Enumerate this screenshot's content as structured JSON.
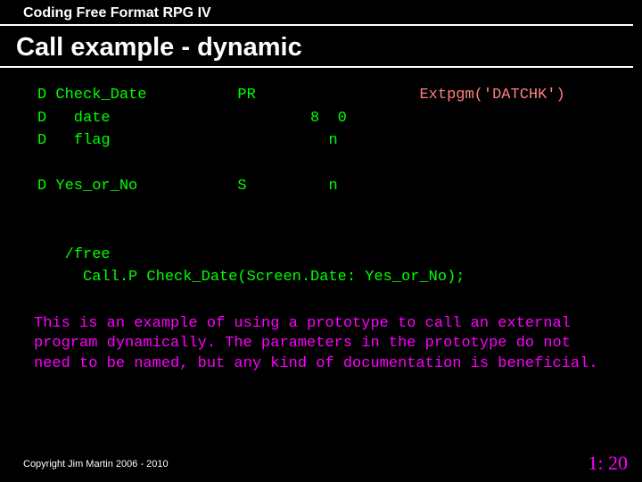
{
  "header": "Coding Free Format RPG IV",
  "title": "Call example - dynamic",
  "code": {
    "l1a": "D Check_Date          PR",
    "l1b": "                  Extpgm('DATCHK')",
    "l2": "D   date                      8  0",
    "l3": "D   flag                        n",
    "l4": "",
    "l5": "D Yes_or_No           S         n",
    "l6": "",
    "l7": "",
    "l8": "   /free",
    "l9": "     Call.P Check_Date(Screen.Date: Yes_or_No);"
  },
  "body": "This is an example of using a prototype to call an external program dynamically. The parameters in the prototype do not need to be named, but any kind of documentation is beneficial.",
  "copyright": "Copyright Jim Martin 2006 - 2010",
  "pagenum": "1: 20"
}
